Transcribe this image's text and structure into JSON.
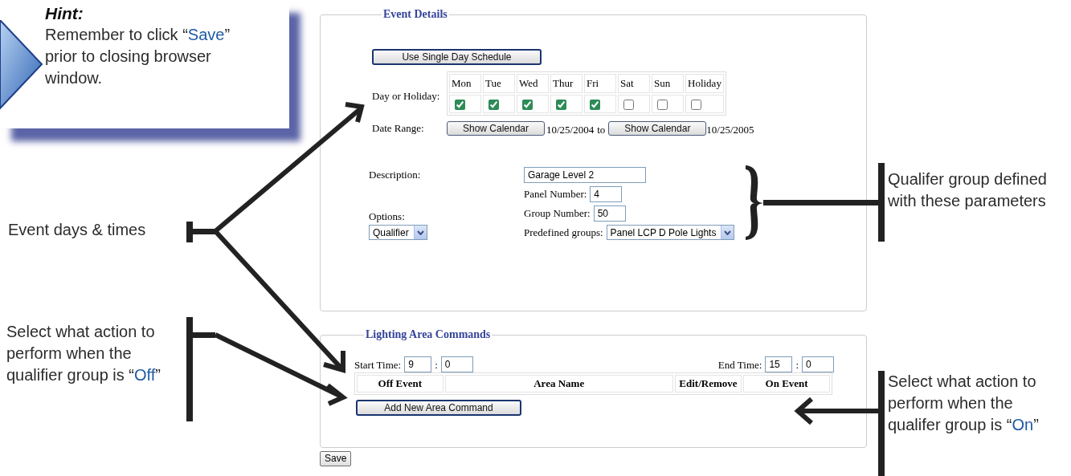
{
  "hint": {
    "title": "Hint:",
    "parts": [
      {
        "text": "Remember to click “",
        "kind": "plain"
      },
      {
        "text": "Save",
        "kind": "highlight"
      },
      {
        "text": "” prior to closing browser window.",
        "kind": "plain"
      }
    ]
  },
  "event_details": {
    "legend": "Event Details",
    "single_day_button": "Use Single Day Schedule",
    "day_label": "Day or Holiday:",
    "days": [
      {
        "label": "Mon",
        "checked": true
      },
      {
        "label": "Tue",
        "checked": true
      },
      {
        "label": "Wed",
        "checked": true
      },
      {
        "label": "Thur",
        "checked": true
      },
      {
        "label": "Fri",
        "checked": true
      },
      {
        "label": "Sat",
        "checked": false
      },
      {
        "label": "Sun",
        "checked": false
      },
      {
        "label": "Holiday",
        "checked": false
      }
    ],
    "date_range": {
      "label": "Date Range:",
      "start_button": "Show Calendar",
      "start_date": "10/25/2004",
      "to": "to",
      "end_button": "Show Calendar",
      "end_date": "10/25/2005"
    },
    "description": {
      "label": "Description:",
      "value": "Garage Level 2"
    },
    "panel_number": {
      "label": "Panel Number:",
      "value": "4"
    },
    "group_number": {
      "label": "Group Number:",
      "value": "50"
    },
    "options": {
      "label": "Options:",
      "value": "Qualifier"
    },
    "predefined_groups": {
      "label": "Predefined groups:",
      "value": "Panel LCP D Pole Lights"
    }
  },
  "lighting_area_commands": {
    "legend": "Lighting Area Commands",
    "start_time": {
      "label": "Start Time:",
      "hour": "9",
      "separator": ":",
      "minute": "0"
    },
    "end_time": {
      "label": "End Time:",
      "hour": "15",
      "separator": ":",
      "minute": "0"
    },
    "columns": [
      "Off Event",
      "Area Name",
      "Edit/Remove",
      "On Event"
    ],
    "add_button": "Add New Area Command"
  },
  "save_button": "Save",
  "annotations": [
    {
      "parts": [
        {
          "text": "Event days & times",
          "kind": "plain"
        }
      ]
    },
    {
      "parts": [
        {
          "text": "Select what action to perform when the qualifier group is “",
          "kind": "plain"
        },
        {
          "text": "Off",
          "kind": "highlight"
        },
        {
          "text": "”",
          "kind": "plain"
        }
      ]
    },
    {
      "parts": [
        {
          "text": "Qualifer group defined with these parameters",
          "kind": "plain"
        }
      ]
    },
    {
      "parts": [
        {
          "text": "Select what action to perform when the qualifer group is “",
          "kind": "plain"
        },
        {
          "text": "On",
          "kind": "highlight"
        },
        {
          "text": "”",
          "kind": "plain"
        }
      ]
    }
  ]
}
